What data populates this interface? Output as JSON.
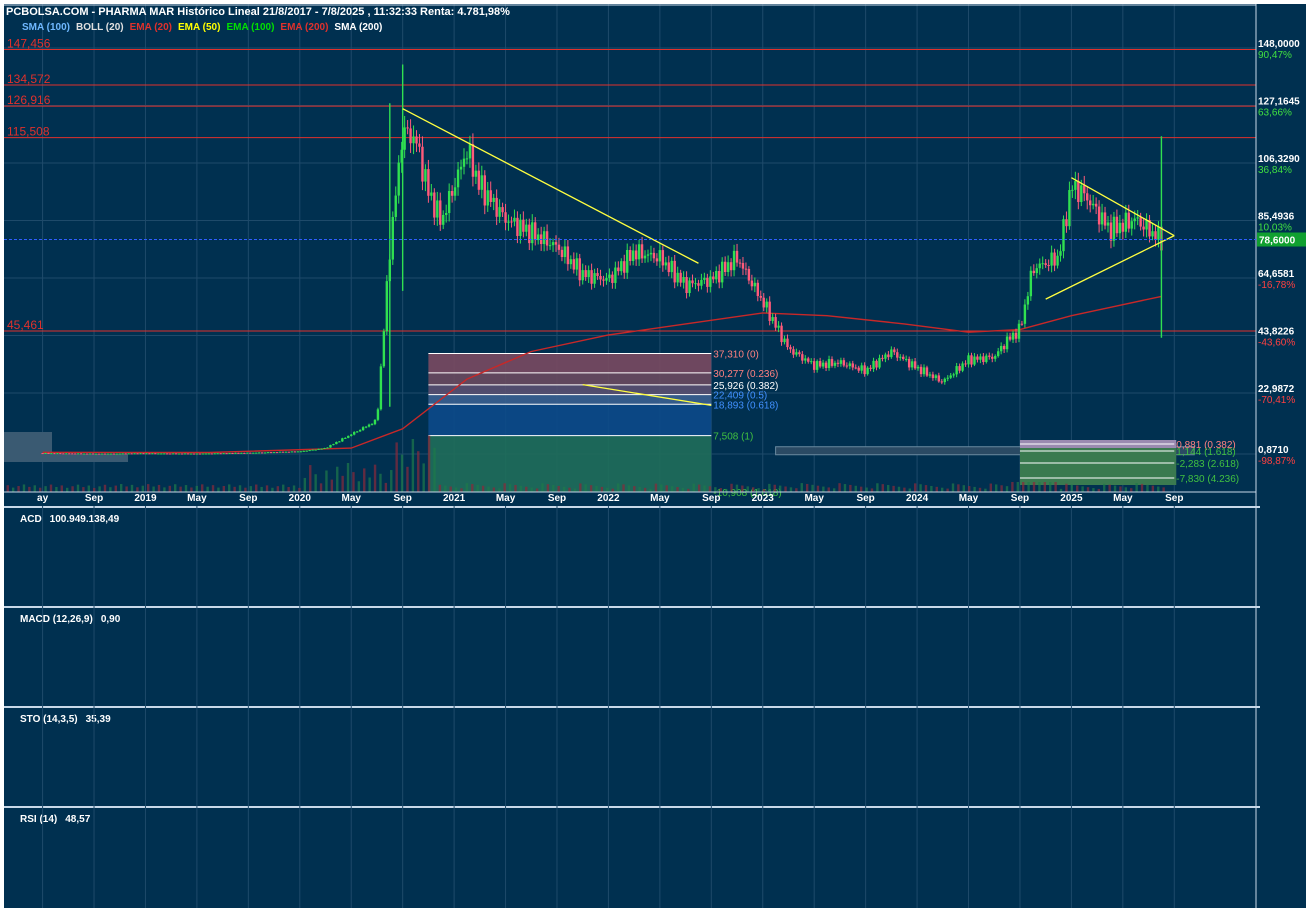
{
  "header": {
    "title": "PCBOLSA.COM - PHARMA MAR Histórico Lineal 21/8/2017 - 7/8/2025 , 11:32:33 Renta: 4.781,98%"
  },
  "indicators": [
    {
      "label": "SMA (100)",
      "color": "#6fb8ff"
    },
    {
      "label": "BOLL (20)",
      "color": "#e0e0e0"
    },
    {
      "label": "EMA (20)",
      "color": "#e0312c"
    },
    {
      "label": "EMA (50)",
      "color": "#ffff00"
    },
    {
      "label": "EMA (100)",
      "color": "#00e000"
    },
    {
      "label": "EMA (200)",
      "color": "#e0312c"
    },
    {
      "label": "SMA (200)",
      "color": "#ffffff"
    }
  ],
  "colors": {
    "background": "#003050",
    "up_candle": "#30e050",
    "down_candle": "#ff5a7a",
    "resistance": "#e0312c",
    "trendline": "#ffff40",
    "ema200": "#c82828",
    "last_price_bg": "#10a030"
  },
  "chart_data": {
    "type": "candlestick",
    "title": "PHARMA MAR Histórico Lineal 21/8/2017 - 7/8/2025",
    "x_axis_labels": [
      "ay",
      "Sep",
      "2019",
      "May",
      "Sep",
      "2020",
      "May",
      "Sep",
      "2021",
      "May",
      "Sep",
      "2022",
      "May",
      "Sep",
      "2023",
      "May",
      "Sep",
      "2024",
      "May",
      "Sep",
      "2025",
      "May",
      "Sep"
    ],
    "y_axis": [
      {
        "price": "148,0000",
        "pct": "90,47%",
        "pct_color": "#40e040"
      },
      {
        "price": "127,1645",
        "pct": "63,66%",
        "pct_color": "#40e040"
      },
      {
        "price": "106,3290",
        "pct": "36,84%",
        "pct_color": "#40e040"
      },
      {
        "price": "85,4936",
        "pct": "10,03%",
        "pct_color": "#40e040"
      },
      {
        "price": "64,6581",
        "pct": "-16,78%",
        "pct_color": "#ff4040"
      },
      {
        "price": "43,8226",
        "pct": "-43,60%",
        "pct_color": "#ff4040"
      },
      {
        "price": "22,9872",
        "pct": "-70,41%",
        "pct_color": "#ff4040"
      },
      {
        "price": "0,8710",
        "pct": "-98,87%",
        "pct_color": "#ff4040"
      }
    ],
    "last_price": "78,6000",
    "resistance_levels": [
      "147,456",
      "134,572",
      "126,916",
      "115,508",
      "45,461"
    ],
    "fibonacci_left": [
      {
        "label": "37,310 (0)",
        "color": "#ff8080"
      },
      {
        "label": "30,277 (0.236)",
        "color": "#ff8080"
      },
      {
        "label": "25,926 (0.382)",
        "color": "#ffffff"
      },
      {
        "label": "22,409 (0.5)",
        "color": "#4090ff"
      },
      {
        "label": "18,893 (0.618)",
        "color": "#4090ff"
      },
      {
        "label": "7,508 (1)",
        "color": "#40c040"
      },
      {
        "label": "-10,908 (1.618)",
        "color": "#40c040"
      }
    ],
    "fibonacci_right": [
      {
        "label": "0,881 (0.382)",
        "color": "#ff8080"
      },
      {
        "label": "1,144 (1.618)",
        "color": "#40c040"
      },
      {
        "label": "-2,283 (2.618)",
        "color": "#40c040"
      },
      {
        "label": "-7,830 (4.236)",
        "color": "#40c040"
      }
    ],
    "series": [
      {
        "name": "PHARMA MAR",
        "x": [
          "2018-05",
          "2018-09",
          "2019-01",
          "2019-05",
          "2019-09",
          "2020-01",
          "2020-03",
          "2020-05",
          "2020-07",
          "2020-08",
          "2020-09",
          "2020-10",
          "2020-11",
          "2020-12",
          "2021-02",
          "2021-03",
          "2021-05",
          "2021-07",
          "2021-09",
          "2021-11",
          "2022-01",
          "2022-03",
          "2022-05",
          "2022-07",
          "2022-09",
          "2022-11",
          "2023-01",
          "2023-03",
          "2023-05",
          "2023-07",
          "2023-09",
          "2023-11",
          "2024-01",
          "2024-03",
          "2024-05",
          "2024-07",
          "2024-08",
          "2024-09",
          "2024-10",
          "2024-12",
          "2025-01",
          "2025-02",
          "2025-04",
          "2025-06",
          "2025-07",
          "2025-08"
        ],
        "y": [
          1.2,
          1.0,
          1.1,
          1.0,
          1.3,
          1.8,
          3.0,
          8.0,
          13.0,
          75.0,
          118.0,
          115.0,
          96.0,
          85.0,
          111.0,
          98.0,
          86.0,
          81.0,
          76.0,
          66.0,
          64.0,
          74.0,
          72.0,
          62.0,
          64.0,
          72.0,
          56.0,
          39.0,
          33.0,
          34.0,
          31.0,
          38.0,
          32.0,
          27.0,
          35.0,
          36.0,
          42.0,
          46.0,
          68.0,
          72.0,
          98.0,
          95.0,
          82.0,
          86.0,
          82.0,
          78.6
        ]
      },
      {
        "name": "EMA (200)",
        "x": [
          "2018-05",
          "2019-06",
          "2020-05",
          "2020-09",
          "2021-02",
          "2021-07",
          "2022-01",
          "2022-07",
          "2023-01",
          "2023-06",
          "2023-12",
          "2024-05",
          "2024-09",
          "2025-01",
          "2025-04",
          "2025-08"
        ],
        "y": [
          1.5,
          1.4,
          3.0,
          10.0,
          28.0,
          38.0,
          44.0,
          48.0,
          52.0,
          51.0,
          48.0,
          45.0,
          46.0,
          51.0,
          54.0,
          58.0
        ]
      }
    ],
    "trendlines": [
      {
        "from": [
          "2020-09",
          126.0
        ],
        "to": [
          "2022-08",
          70.0
        ]
      },
      {
        "from": [
          "2024-11",
          57.0
        ],
        "to": [
          "2025-09",
          80.0
        ]
      },
      {
        "from": [
          "2025-01",
          101.0
        ],
        "to": [
          "2025-09",
          80.0
        ]
      },
      {
        "from": [
          "2021-11",
          26.0
        ],
        "to": [
          "2022-09",
          18.5
        ]
      }
    ],
    "grid": true
  },
  "panels": [
    {
      "name": "ACD",
      "value": "100.949.138,49"
    },
    {
      "name": "MACD (12,26,9)",
      "value": "0,90"
    },
    {
      "name": "STO (14,3,5)",
      "value": "35,39"
    },
    {
      "name": "RSI (14)",
      "value": "48,57"
    }
  ]
}
